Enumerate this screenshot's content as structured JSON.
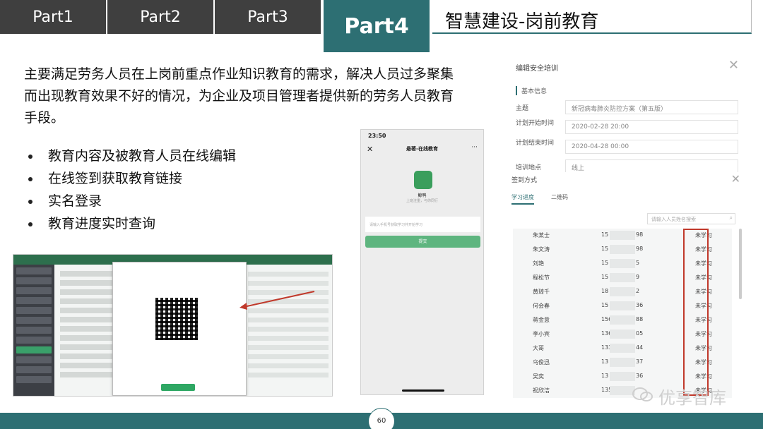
{
  "tabs": [
    "Part1",
    "Part2",
    "Part3",
    "Part4"
  ],
  "header_title": "智慧建设-岗前教育",
  "intro": "主要满足劳务人员在上岗前重点作业知识教育的需求，解决人员过多聚集而出现教育效果不好的情况，为企业及项目管理者提供新的劳务人员教育手段。",
  "bullets": [
    "教育内容及被教育人员在线编辑",
    "在线签到获取教育链接",
    "实名登录",
    "教育进度实时查询"
  ],
  "phone": {
    "time": "23:50",
    "title": "悬著-在线教育",
    "app_name": "鲸鸭",
    "subtitle": "上班注重，与你同行",
    "input_placeholder": "请输入手机号获取学习并开始学习",
    "submit_label": "提交"
  },
  "dialog": {
    "title": "编辑安全培训",
    "section": "基本信息",
    "fields": [
      {
        "label": "主题",
        "value": "新冠病毒肺炎防控方案（第五版）"
      },
      {
        "label": "计划开始时间",
        "value": "2020-02-28 20:00"
      },
      {
        "label": "计划结束时间",
        "value": "2020-04-28 00:00"
      },
      {
        "label": "培训地点",
        "value": "线上"
      }
    ]
  },
  "signin": {
    "title": "签到方式",
    "tabs": [
      "学习进度",
      "二维码"
    ],
    "search_placeholder": "请输入人员姓名搜索",
    "rows": [
      {
        "name": "朱某士",
        "prefix": "15",
        "suffix": "98",
        "status": "未学习"
      },
      {
        "name": "朱文涛",
        "prefix": "15",
        "suffix": "98",
        "status": "未学习"
      },
      {
        "name": "刘艳",
        "prefix": "15",
        "suffix": "5",
        "status": "未学习"
      },
      {
        "name": "程松节",
        "prefix": "15",
        "suffix": "9",
        "status": "未学习"
      },
      {
        "name": "黄琦千",
        "prefix": "18",
        "suffix": "2",
        "status": "未学习"
      },
      {
        "name": "何会春",
        "prefix": "15",
        "suffix": "36",
        "status": "未学习"
      },
      {
        "name": "蒋金意",
        "prefix": "156",
        "suffix": "88",
        "status": "未学习"
      },
      {
        "name": "李小宾",
        "prefix": "136",
        "suffix": "05",
        "status": "未学习"
      },
      {
        "name": "大哥",
        "prefix": "133",
        "suffix": "44",
        "status": "未学习"
      },
      {
        "name": "乌俊迅",
        "prefix": "13",
        "suffix": "37",
        "status": "未学习"
      },
      {
        "name": "吴奕",
        "prefix": "13",
        "suffix": "36",
        "status": "未学习"
      },
      {
        "name": "祝欣洁",
        "prefix": "135",
        "suffix": "",
        "status": "未学习"
      }
    ]
  },
  "page_number": "60",
  "watermark": "优享智库",
  "colors": {
    "accent": "#2d6f73",
    "tab_dark": "#3f3f3f",
    "highlight": "#c0392b"
  }
}
